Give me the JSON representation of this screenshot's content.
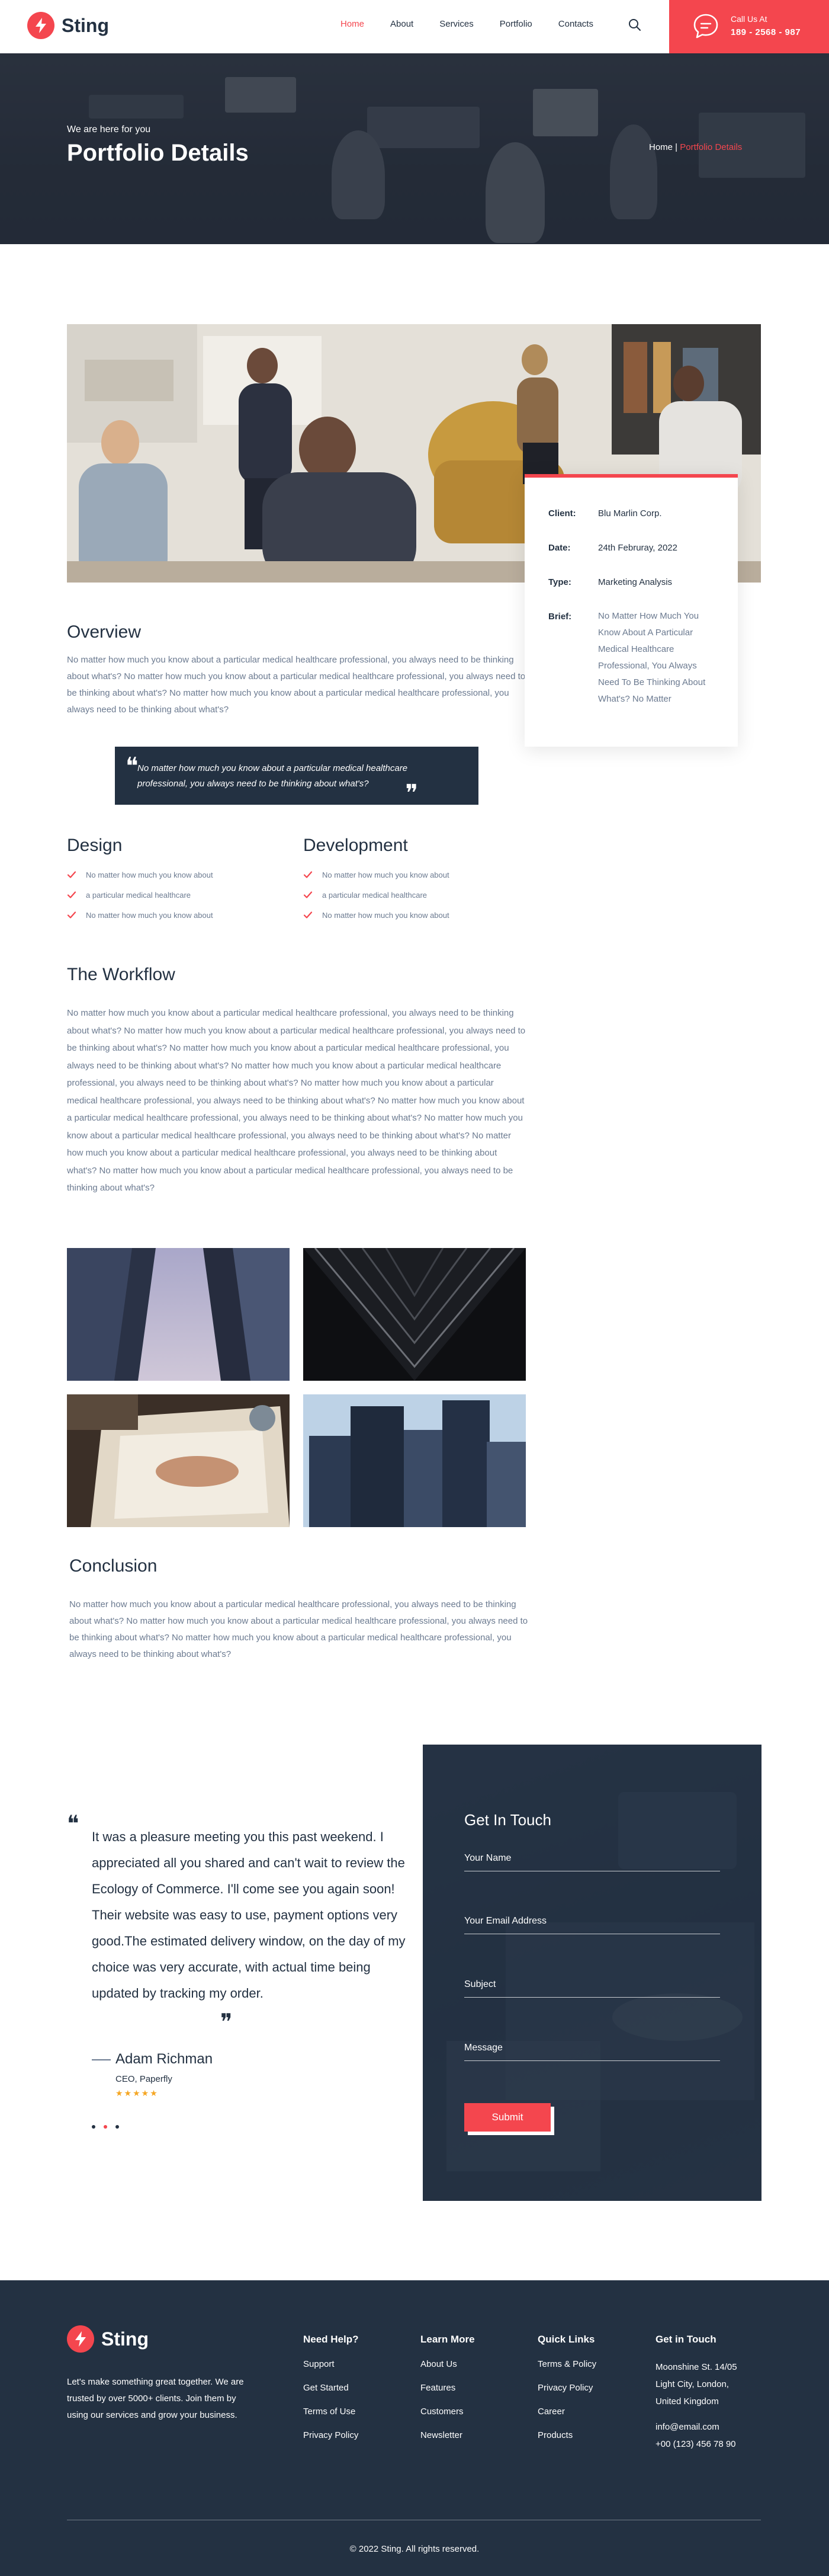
{
  "brand": {
    "name": "Sting",
    "accent": "#f4464e",
    "dark": "#233142"
  },
  "nav": {
    "items": [
      {
        "label": "Home",
        "active": true
      },
      {
        "label": "About",
        "active": false
      },
      {
        "label": "Services",
        "active": false
      },
      {
        "label": "Portfolio",
        "active": false
      },
      {
        "label": "Contacts",
        "active": false
      }
    ],
    "search_icon": "search-icon"
  },
  "call": {
    "label": "Call Us At",
    "number": "189 - 2568 - 987",
    "icon": "chat-bubble-icon"
  },
  "hero": {
    "subtitle": "We are here for you",
    "title": "Portfolio Details",
    "breadcrumb_home": "Home",
    "breadcrumb_sep": " | ",
    "breadcrumb_current": "Portfolio Details"
  },
  "info": {
    "client_label": "Client:",
    "client": "Blu Marlin Corp.",
    "date_label": "Date:",
    "date": "24th Februray, 2022",
    "type_label": "Type:",
    "type": "Marketing Analysis",
    "brief_label": "Brief:",
    "brief": "No Matter How Much You Know About A Particular Medical Healthcare Professional, You Always Need To Be Thinking About What's? No Matter"
  },
  "overview": {
    "title": "Overview",
    "text": "No matter how much you know about a particular medical healthcare professional, you always need to be thinking about what's? No matter how much you know about a particular medical healthcare professional, you always need to be thinking about what's? No matter how much you know about a particular medical healthcare professional, you always need to be thinking about what's?"
  },
  "quote": {
    "text": "No matter how much you know about a particular medical healthcare professional, you always need to be thinking about what's?"
  },
  "design": {
    "title": "Design",
    "items": [
      "No matter how much you know about",
      "a particular medical healthcare",
      "No matter how much you know about"
    ]
  },
  "development": {
    "title": "Development",
    "items": [
      "No matter how much you know about",
      "a particular medical healthcare",
      "No matter how much you know about"
    ]
  },
  "workflow": {
    "title": "The Workflow",
    "text": "No matter how much you know about a particular medical healthcare professional, you always need to be thinking about what's? No matter how much you know about a particular medical healthcare professional, you always need to be thinking about what's? No matter how much you know about a particular medical healthcare professional, you always need to be thinking about what's? No matter how much you know about a particular medical healthcare professional, you always need to be thinking about what's? No matter how much you know about a particular medical healthcare professional, you always need to be thinking about what's? No matter how much you know about a particular medical healthcare professional, you always need to be thinking about what's? No matter how much you know about a particular medical healthcare professional, you always need to be thinking about what's? No matter how much you know about a particular medical healthcare professional, you always need to be thinking about what's? No matter how much you know about a particular medical healthcare professional, you always need to be thinking about what's?"
  },
  "conclusion": {
    "title": "Conclusion",
    "text": "No matter how much you know about a particular medical healthcare professional, you always need to be thinking about what's? No matter how much you know about a particular medical healthcare professional, you always need to be thinking about what's? No matter how much you know about a particular medical healthcare professional, you always need to be thinking about what's?"
  },
  "testimonial": {
    "text": "It was a pleasure meeting you this past weekend. I appreciated all you shared and can't wait to review the Ecology of Commerce. I'll come see you again soon! Their website was easy to use, payment options very good.The estimated delivery window, on the day of my choice was very accurate, with actual time being updated by tracking my order.",
    "name": "Adam Richman",
    "role": "CEO, Paperfly",
    "stars": "★★★★★",
    "rating": 5,
    "slides": 3,
    "active_slide": 2
  },
  "form": {
    "title": "Get In Touch",
    "name_placeholder": "Your Name",
    "email_placeholder": "Your Email Address",
    "subject_placeholder": "Subject",
    "message_placeholder": "Message",
    "submit_label": "Submit"
  },
  "footer": {
    "description": "Let's make something great together. We are trusted by over 5000+ clients. Join them by using our services and grow your business.",
    "help": {
      "title": "Need Help?",
      "links": [
        "Support",
        "Get Started",
        "Terms of Use",
        "Privacy Policy"
      ]
    },
    "learn": {
      "title": "Learn More",
      "links": [
        "About Us",
        "Features",
        "Customers",
        "Newsletter"
      ]
    },
    "quick": {
      "title": "Quick Links",
      "links": [
        "Terms & Policy",
        "Privacy Policy",
        "Career",
        "Products"
      ]
    },
    "contact": {
      "title": "Get in Touch",
      "address_1": "Moonshine St. 14/05",
      "address_2": "Light City, London,",
      "address_3": "United Kingdom",
      "email": "info@email.com",
      "phone": "+00 (123) 456 78 90"
    },
    "copyright": "© 2022 Sting. All rights reserved."
  }
}
